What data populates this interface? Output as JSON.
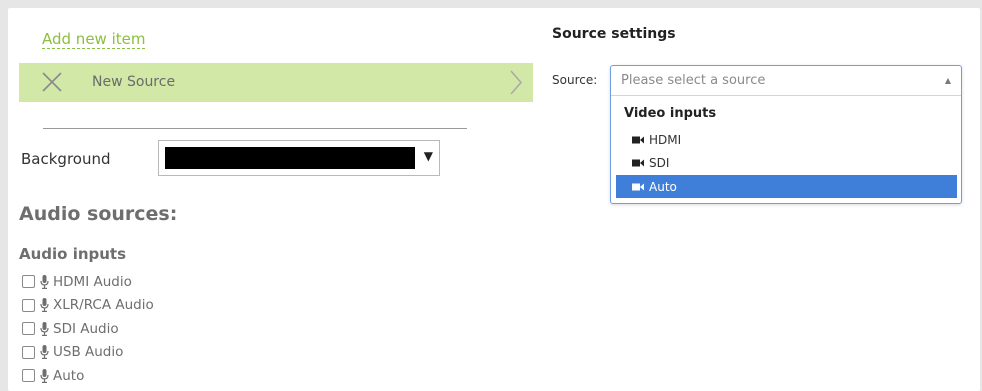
{
  "add_new_item": "Add new item",
  "current_item": {
    "label": "New Source"
  },
  "background": {
    "label": "Background",
    "color": "#000000"
  },
  "audio": {
    "title": "Audio sources:",
    "group": "Audio inputs",
    "items": [
      {
        "label": "HDMI Audio",
        "icon": "microphone-icon",
        "checked": false
      },
      {
        "label": "XLR/RCA Audio",
        "icon": "microphone-icon",
        "checked": false
      },
      {
        "label": "SDI Audio",
        "icon": "microphone-icon",
        "checked": false
      },
      {
        "label": "USB Audio",
        "icon": "microphone-icon",
        "checked": false
      },
      {
        "label": "Auto",
        "icon": "microphone-icon",
        "checked": false
      }
    ]
  },
  "source_settings": {
    "title": "Source settings",
    "source_label": "Source:",
    "placeholder": "Please select a source",
    "group_label": "Video inputs",
    "options": [
      {
        "label": "HDMI",
        "icon": "camera-icon",
        "selected": false
      },
      {
        "label": "SDI",
        "icon": "camera-icon",
        "selected": false
      },
      {
        "label": "Auto",
        "icon": "camera-icon",
        "selected": true
      }
    ]
  },
  "colors": {
    "accent_green": "#8cbf3f",
    "row_green": "#d2e8a6",
    "select_blue": "#3f7fd9"
  }
}
